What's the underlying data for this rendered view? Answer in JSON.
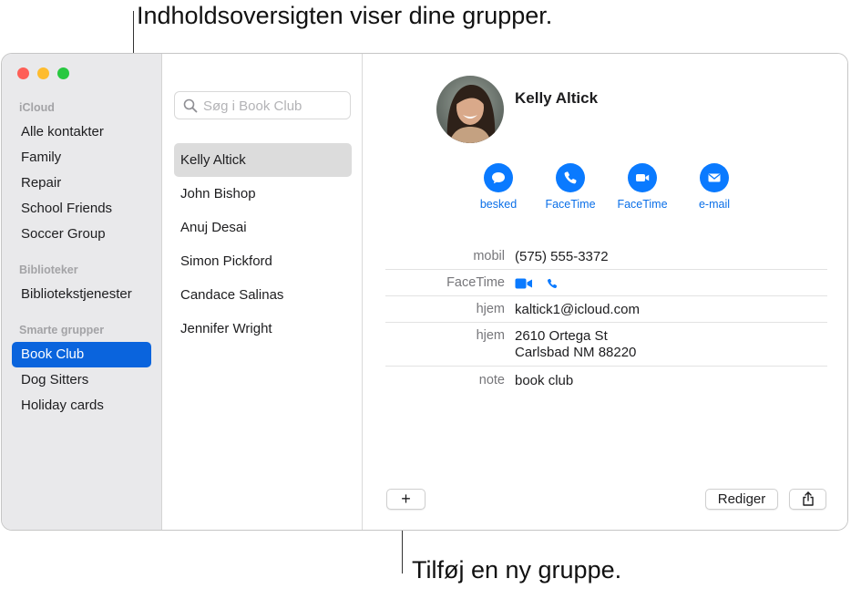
{
  "annotations": {
    "top": "Indholdsoversigten viser dine grupper.",
    "bottom": "Tilføj en ny gruppe."
  },
  "sidebar": {
    "sections": [
      {
        "title": "iCloud",
        "items": [
          "Alle kontakter",
          "Family",
          "Repair",
          "School Friends",
          "Soccer Group"
        ]
      },
      {
        "title": "Biblioteker",
        "items": [
          "Bibliotekstjenester"
        ]
      },
      {
        "title": "Smarte grupper",
        "items": [
          "Book Club",
          "Dog Sitters",
          "Holiday cards"
        ]
      }
    ],
    "selected": "Book Club"
  },
  "search": {
    "placeholder": "Søg i Book Club",
    "value": ""
  },
  "contacts": [
    "Kelly Altick",
    "John Bishop",
    "Anuj Desai",
    "Simon Pickford",
    "Candace Salinas",
    "Jennifer Wright"
  ],
  "selected_contact": "Kelly Altick",
  "detail": {
    "name": "Kelly Altick",
    "actions": [
      {
        "label": "besked",
        "icon": "message-bubble-icon"
      },
      {
        "label": "FaceTime",
        "icon": "phone-icon"
      },
      {
        "label": "FaceTime",
        "icon": "video-camera-icon"
      },
      {
        "label": "e-mail",
        "icon": "envelope-icon"
      }
    ],
    "fields": [
      {
        "label": "mobil",
        "value": "(575) 555-3372"
      },
      {
        "label": "FaceTime",
        "icons": [
          "video-camera-icon",
          "phone-icon"
        ]
      },
      {
        "label": "hjem",
        "value": "kaltick1@icloud.com"
      },
      {
        "label": "hjem",
        "lines": [
          "2610 Ortega St",
          "Carlsbad NM 88220"
        ]
      },
      {
        "label": "note",
        "value": "book club"
      }
    ]
  },
  "footer": {
    "add_label": "+",
    "edit_label": "Rediger",
    "share_icon": "share-icon"
  },
  "colors": {
    "accent": "#0a64dd",
    "action_blue": "#0a7aff",
    "sidebar_bg": "#e9e9eb"
  }
}
